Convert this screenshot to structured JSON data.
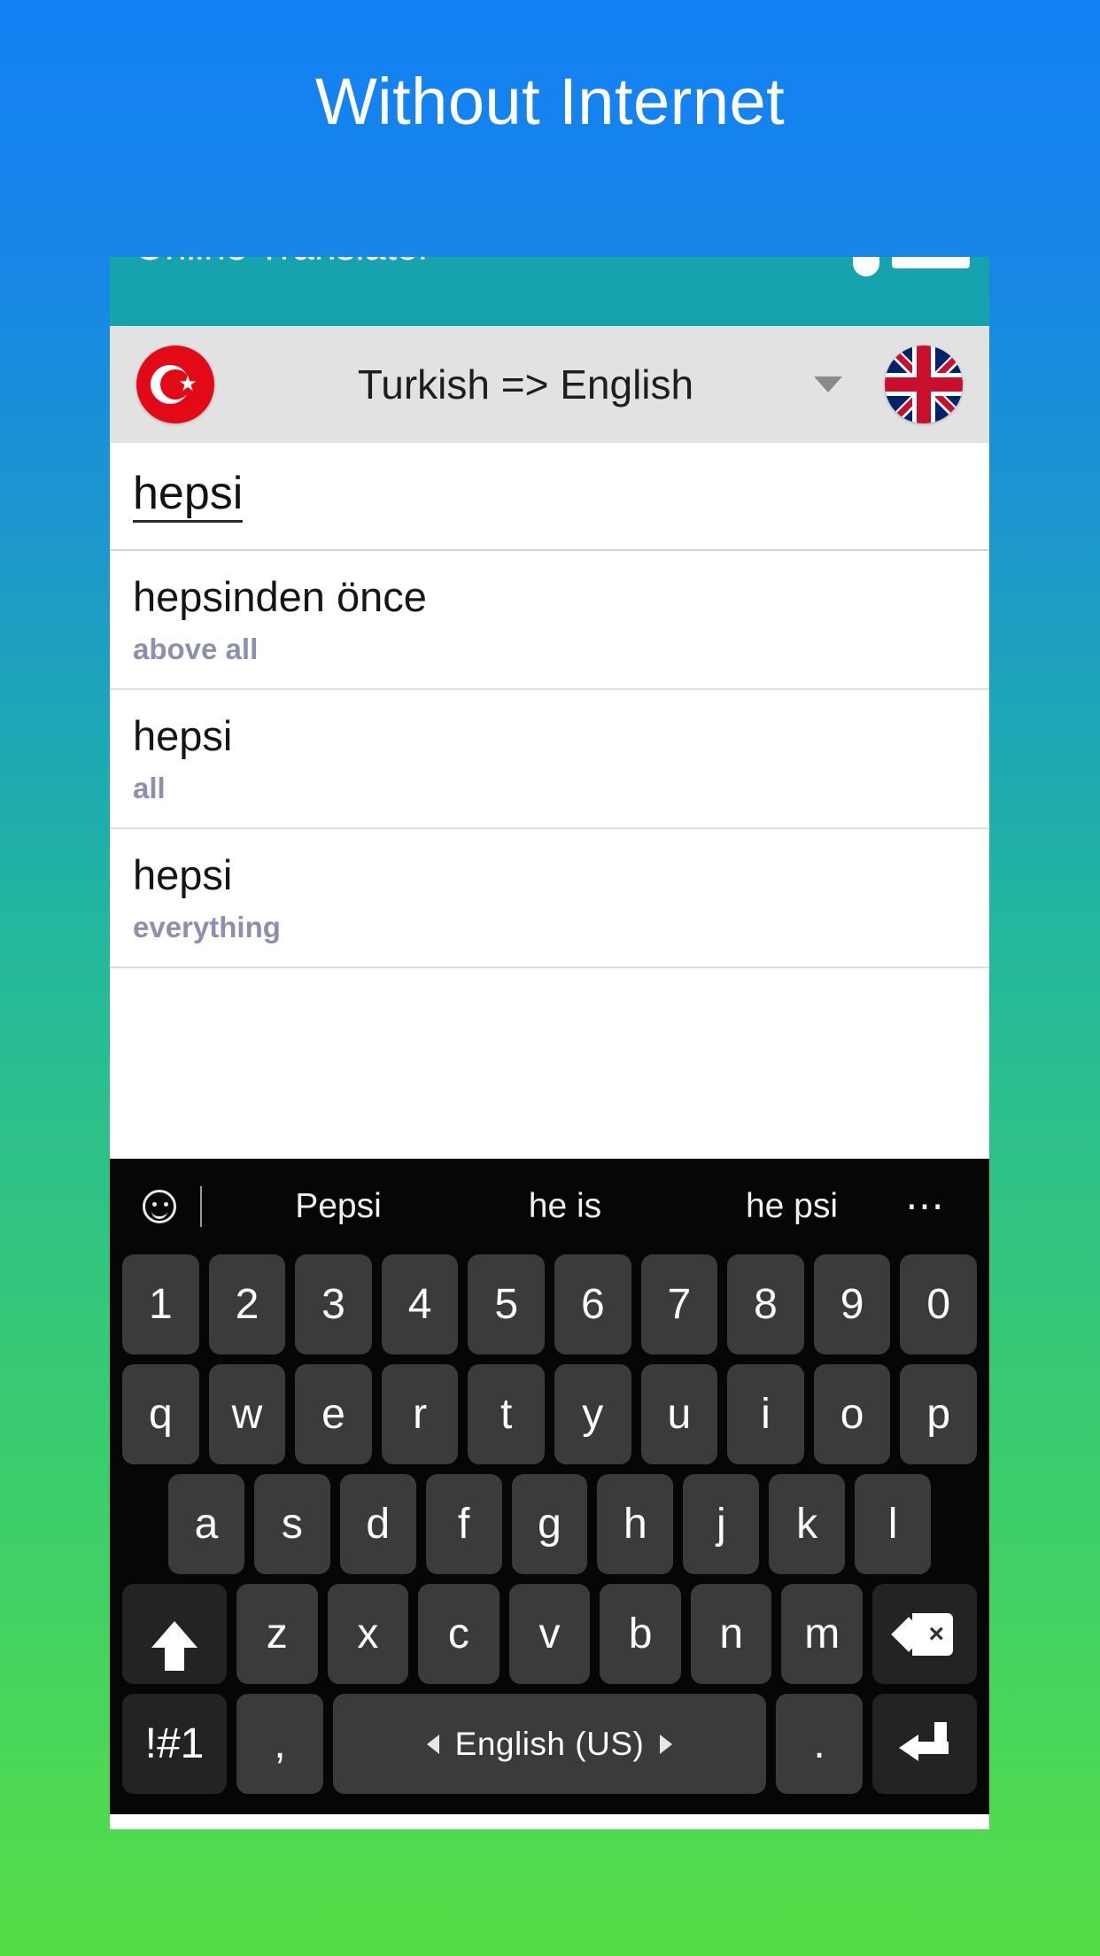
{
  "promo": {
    "headline": "Without Internet",
    "background_top": "#1380f5",
    "background_bottom": "#55dd44"
  },
  "app": {
    "appbar": {
      "title": "Online Translator",
      "color": "#16a3ae",
      "icons": [
        "mic-icon",
        "menu-bar-icon"
      ]
    },
    "language_selector": {
      "source_flag": "turkey-flag-icon",
      "target_flag": "united-kingdom-flag-icon",
      "label": "Turkish => English",
      "caret": "chevron-down-icon"
    },
    "search": {
      "value": "hepsi",
      "placeholder": "hepsi"
    },
    "results": [
      {
        "source": "hepsinden önce",
        "target": "above all"
      },
      {
        "source": "hepsi",
        "target": "all"
      },
      {
        "source": "hepsi",
        "target": "everything"
      }
    ],
    "result_target_color": "#8d8fae"
  },
  "keyboard": {
    "suggestions": [
      "Pepsi",
      "he is",
      "he psi"
    ],
    "emoji_icon": "emoji-smiley-icon",
    "more_icon": "overflow-dots-icon",
    "rows": {
      "numbers": [
        "1",
        "2",
        "3",
        "4",
        "5",
        "6",
        "7",
        "8",
        "9",
        "0"
      ],
      "top": [
        "q",
        "w",
        "e",
        "r",
        "t",
        "y",
        "u",
        "i",
        "o",
        "p"
      ],
      "home": [
        "a",
        "s",
        "d",
        "f",
        "g",
        "h",
        "j",
        "k",
        "l"
      ],
      "bottom": [
        "z",
        "x",
        "c",
        "v",
        "b",
        "n",
        "m"
      ]
    },
    "shift_label": "shift-icon",
    "backspace_label": "backspace-icon",
    "symbols_label": "!#1",
    "comma_label": ",",
    "space_label": "English (US)",
    "period_label": ".",
    "enter_label": "enter-icon"
  }
}
